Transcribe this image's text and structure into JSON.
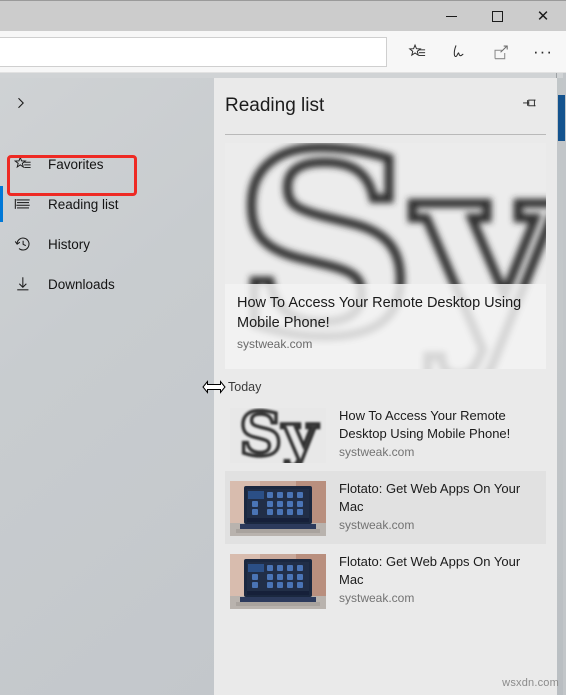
{
  "window": {
    "controls": [
      {
        "name": "minimize",
        "glyph": "minimize-icon"
      },
      {
        "name": "maximize",
        "glyph": "maximize-icon"
      },
      {
        "name": "close",
        "glyph": "close-icon",
        "label": "✕"
      }
    ]
  },
  "toolbar": {
    "address_value": "",
    "address_placeholder": "",
    "actions": [
      {
        "name": "favorites-add-icon",
        "label": "Add to favorites or reading list"
      },
      {
        "name": "web-note-icon",
        "label": "Make a Web Note"
      },
      {
        "name": "share-icon",
        "label": "Share"
      },
      {
        "name": "more-options-icon",
        "label": "···"
      }
    ]
  },
  "hub": {
    "expand_label": "›",
    "nav_items": [
      {
        "id": "favorites",
        "label": "Favorites",
        "icon": "favorites-icon",
        "selected": false
      },
      {
        "id": "reading-list",
        "label": "Reading list",
        "icon": "reading-list-icon",
        "selected": true
      },
      {
        "id": "history",
        "label": "History",
        "icon": "history-icon",
        "selected": false
      },
      {
        "id": "downloads",
        "label": "Downloads",
        "icon": "downloads-icon",
        "selected": false
      }
    ],
    "pane": {
      "title": "Reading list",
      "pin_label": "Pin this pane",
      "featured": {
        "title": "How To Access Your Remote Desktop Using Mobile Phone!",
        "host": "systweak.com",
        "thumbnail": "systweak-sy-logo"
      },
      "groups": [
        {
          "label": "Today",
          "items": [
            {
              "title": "How To Access Your Remote Desktop Using Mobile Phone!",
              "host": "systweak.com",
              "thumbnail": "systweak-sy-logo",
              "hover": false
            },
            {
              "title": "Flotato: Get Web Apps On Your Mac",
              "host": "systweak.com",
              "thumbnail": "macbook-desktop-photo",
              "hover": true
            },
            {
              "title": "Flotato: Get Web Apps On Your Mac",
              "host": "systweak.com",
              "thumbnail": "macbook-desktop-photo",
              "hover": false
            }
          ]
        }
      ]
    }
  },
  "annotation": {
    "type": "red-highlight-rectangle",
    "target": "reading-list"
  },
  "cursor": {
    "type": "horizontal-resize-cursor"
  },
  "watermark": {
    "text": "wsxdn.com"
  },
  "colors": {
    "accent": "#0078d7",
    "annotation": "#ee2a24",
    "pane_bg": "#eaeaea",
    "nav_bg": "#c8cccf",
    "titlebar_bg": "#cccccc"
  }
}
